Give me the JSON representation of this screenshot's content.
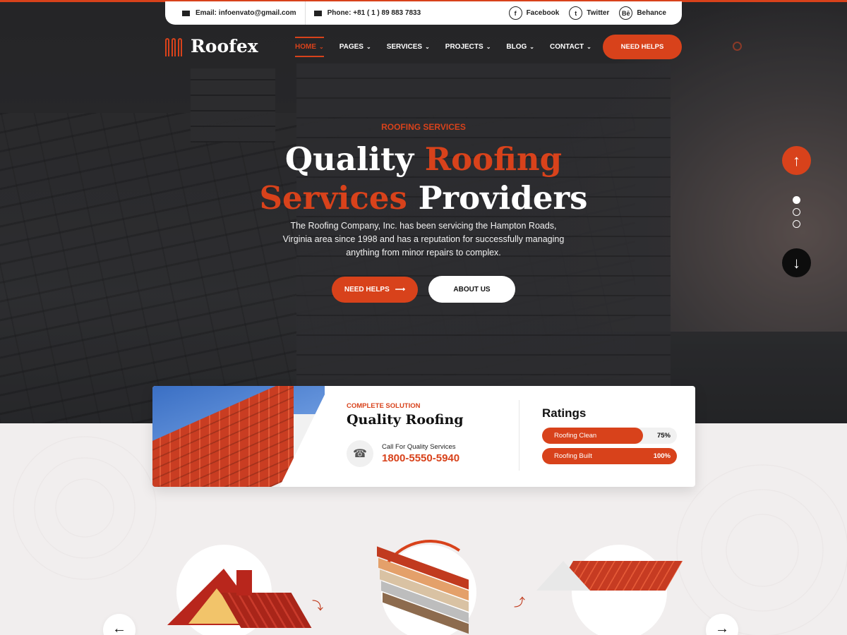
{
  "topbar": {
    "email": "Email: infoenvato@gmail.com",
    "phone": "Phone: +81 ( 1 ) 89 883 7833",
    "social": [
      {
        "icon": "facebook-icon",
        "glyph": "f",
        "label": "Facebook"
      },
      {
        "icon": "twitter-icon",
        "glyph": "t",
        "label": "Twitter"
      },
      {
        "icon": "behance-icon",
        "glyph": "Bē",
        "label": "Behance"
      }
    ]
  },
  "brand": {
    "name": "Roofex",
    "accent": "#d8421b"
  },
  "nav": {
    "items": [
      "HOME",
      "PAGES",
      "SERVICES",
      "PROJECTS",
      "BLOG",
      "CONTACT"
    ],
    "active": "HOME",
    "cta": "NEED HELPS"
  },
  "hero": {
    "kicker": "ROOFING SERVICES",
    "title_line1_white": "Quality",
    "title_line1_orange": "Roofing",
    "title_line2_orange": "Services",
    "title_line2_white": "Providers",
    "description": "The Roofing Company, Inc. has been servicing the Hampton Roads, Virginia area since 1998 and has a reputation for successfully managing anything from minor repairs to complex.",
    "btn_primary": "NEED HELPS",
    "btn_secondary": "ABOUT US",
    "slides_total": 3,
    "slide_active": 1
  },
  "card": {
    "kicker": "COMPLETE SOLUTION",
    "title": "Quality Roofing",
    "call_label": "Call For Quality Services",
    "call_number": "1800-5550-5940",
    "ratings_title": "Ratings",
    "ratings": [
      {
        "label": "Roofing Clean",
        "percent_text": "75%",
        "value": 0.75
      },
      {
        "label": "Roofing Built",
        "percent_text": "100%",
        "value": 1.0
      }
    ]
  }
}
